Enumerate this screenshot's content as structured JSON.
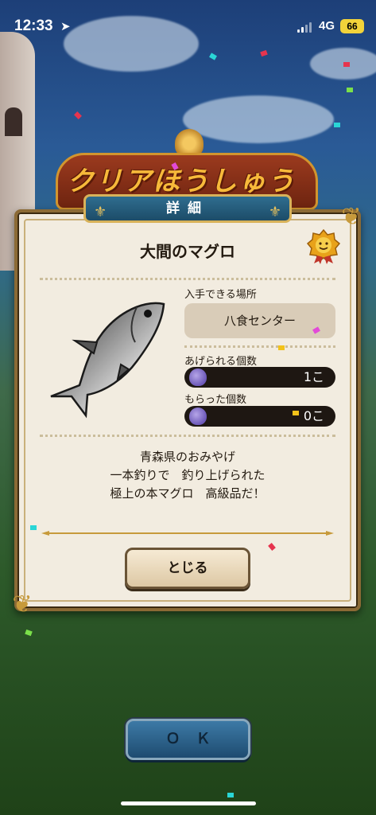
{
  "status_bar": {
    "time": "12:33",
    "network": "4G",
    "battery": "66"
  },
  "banner": {
    "title": "クリアほうしゅう"
  },
  "dialog": {
    "header": "詳細",
    "fish_name": "大間のマグロ",
    "location_label": "入手できる場所",
    "location_value": "八食センター",
    "given_label": "あげられる個数",
    "given_value": "1こ",
    "received_label": "もらった個数",
    "received_value": "0こ",
    "description": [
      "青森県のおみやげ",
      "一本釣りで　釣り上げられた",
      "極上の本マグロ　高級品だ！"
    ],
    "close_label": "とじる"
  },
  "ok_button": {
    "label": "ＯＫ"
  },
  "colors": {
    "dialog_bg": "#f2ece0",
    "header_blue": "#2f6d8f",
    "gold": "#d8b25a",
    "ok_blue": "#3d7aa6"
  }
}
